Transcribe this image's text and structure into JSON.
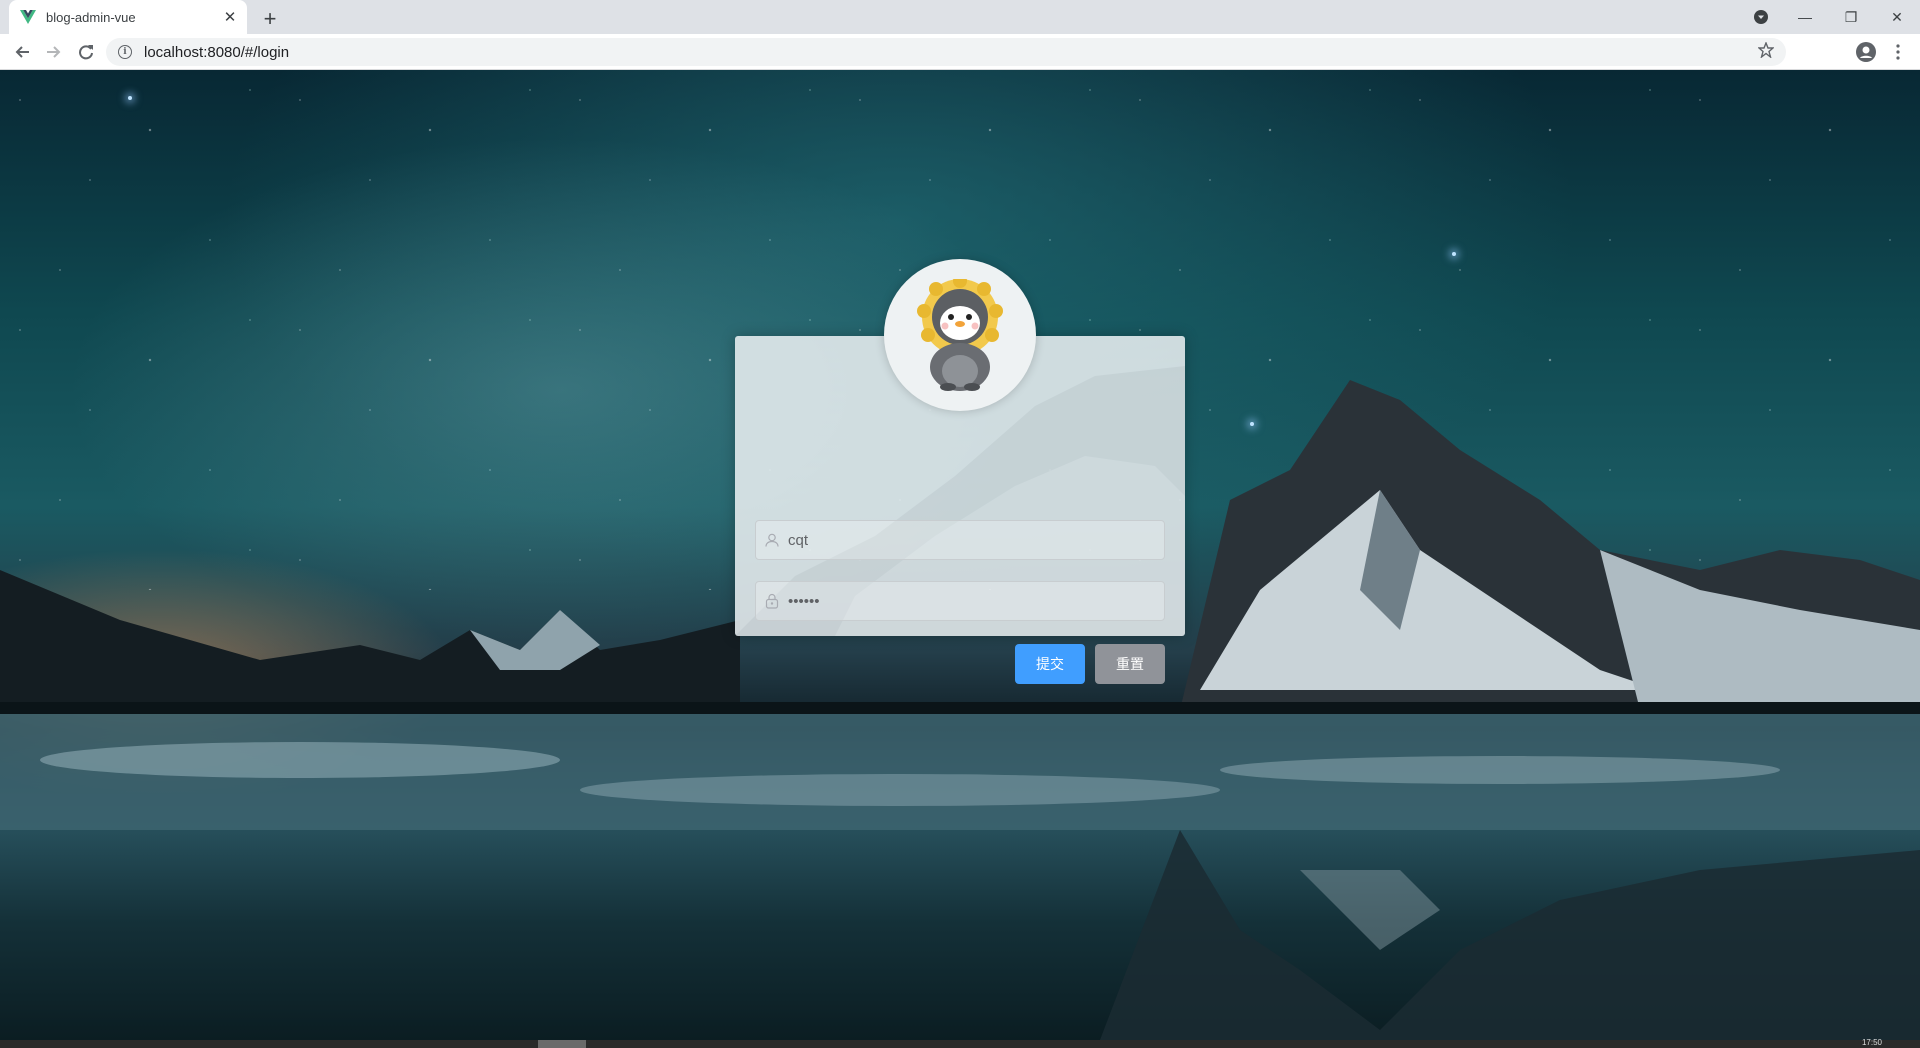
{
  "browser": {
    "tab": {
      "title": "blog-admin-vue",
      "close_glyph": "✕"
    },
    "new_tab_glyph": "+",
    "url": "localhost:8080/#/login",
    "info_glyph": "i",
    "window_controls": {
      "minimize": "—",
      "restore": "❐",
      "close": "✕"
    },
    "favicon_color": "#41b883"
  },
  "login": {
    "username_value": "cqt",
    "password_value": "••••••",
    "submit_label": "提交",
    "reset_label": "重置"
  },
  "taskbar": {
    "clock": "17:50"
  },
  "colors": {
    "primary": "#409eff",
    "secondary": "#909399"
  }
}
